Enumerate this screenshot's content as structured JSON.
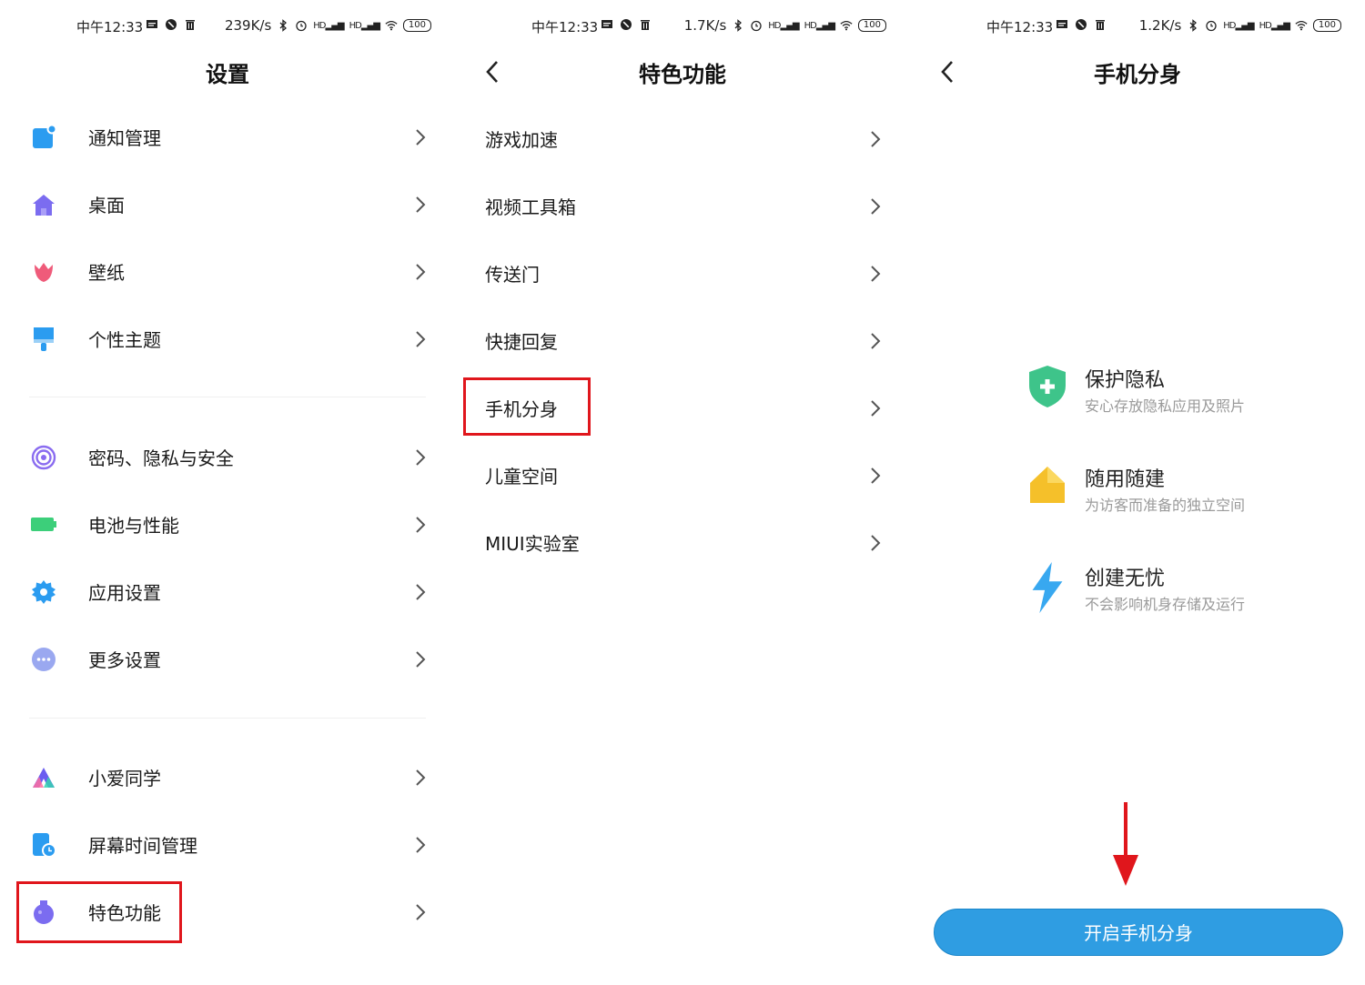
{
  "status_bars": [
    {
      "time": "中午12:33",
      "speed": "239K/s",
      "signal1": "HD",
      "signal2": "HD",
      "battery": "100"
    },
    {
      "time": "中午12:33",
      "speed": "1.7K/s",
      "signal1": "HD",
      "signal2": "HD",
      "battery": "100"
    },
    {
      "time": "中午12:33",
      "speed": "1.2K/s",
      "signal1": "HD",
      "signal2": "HD",
      "battery": "100"
    }
  ],
  "settings": {
    "title": "设置",
    "group1": [
      {
        "label": "通知管理",
        "icon": "notification-icon",
        "color": "#2b9cf0"
      },
      {
        "label": "桌面",
        "icon": "home-icon",
        "color": "#7b6cf0"
      },
      {
        "label": "壁纸",
        "icon": "tulip-icon",
        "color": "#ef5b7a"
      },
      {
        "label": "个性主题",
        "icon": "paintbrush-icon",
        "color": "#2b9cf0"
      }
    ],
    "group2": [
      {
        "label": "密码、隐私与安全",
        "icon": "fingerprint-icon",
        "color": "#8a6cf0"
      },
      {
        "label": "电池与性能",
        "icon": "battery-icon",
        "color": "#3ccf7a"
      },
      {
        "label": "应用设置",
        "icon": "gear-icon",
        "color": "#2b9cf0"
      },
      {
        "label": "更多设置",
        "icon": "more-icon",
        "color": "#9aa8f0"
      }
    ],
    "group3": [
      {
        "label": "小爱同学",
        "icon": "xiaoai-icon",
        "color": "#6a5cf0"
      },
      {
        "label": "屏幕时间管理",
        "icon": "screen-time-icon",
        "color": "#2b9cf0"
      },
      {
        "label": "特色功能",
        "icon": "flask-icon",
        "color": "#7b6cf0"
      }
    ]
  },
  "features": {
    "title": "特色功能",
    "items": [
      "游戏加速",
      "视频工具箱",
      "传送门",
      "快捷回复",
      "手机分身",
      "儿童空间",
      "MIUI实验室"
    ]
  },
  "second_space": {
    "title": "手机分身",
    "features": [
      {
        "name": "保护隐私",
        "desc": "安心存放隐私应用及照片",
        "icon": "shield-icon",
        "color": "#3ec48a"
      },
      {
        "name": "随用随建",
        "desc": "为访客而准备的独立空间",
        "icon": "house-icon",
        "color": "#f5c02a"
      },
      {
        "name": "创建无忧",
        "desc": "不会影响机身存储及运行",
        "icon": "lightning-icon",
        "color": "#38a8f0"
      }
    ],
    "button": "开启手机分身",
    "accent": "#2f9de2",
    "highlight": "#e0161c"
  }
}
